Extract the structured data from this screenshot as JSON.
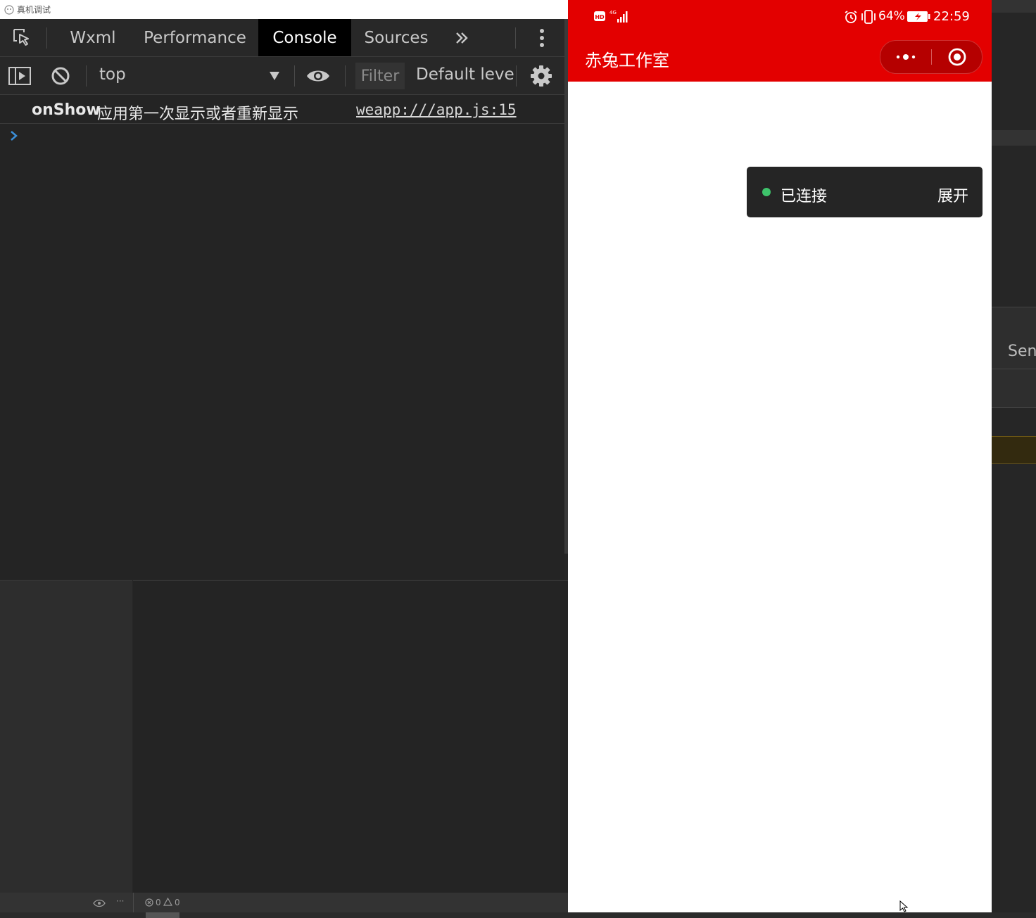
{
  "window": {
    "title": "真机调试"
  },
  "devtools": {
    "tabs": [
      {
        "label": "Wxml",
        "active": false
      },
      {
        "label": "Performance",
        "active": false
      },
      {
        "label": "Console",
        "active": true
      },
      {
        "label": "Sources",
        "active": false
      }
    ],
    "more_tabs_icon": "double-chevron-right-icon",
    "menu_icon": "vertical-dots-icon",
    "toolbar": {
      "context": "top",
      "filter_placeholder": "Filter",
      "level": "Default leve"
    },
    "console": {
      "entries": [
        {
          "method": "onShow",
          "message": "应用第一次显示或者重新显示",
          "source": "weapp:///app.js:15"
        }
      ],
      "prompt": "›"
    }
  },
  "statusbar": {
    "errors": "0",
    "warnings": "0"
  },
  "phone": {
    "status": {
      "network": "4G",
      "battery": "64%",
      "time": "22:59"
    },
    "nav": {
      "title": "赤兔工作室"
    },
    "toast": {
      "status": "已连接",
      "action": "展开",
      "dot_color": "#3ec36b"
    }
  },
  "right_panel": {
    "label": "Sen"
  },
  "colors": {
    "accent_red": "#e30000",
    "active_tab": "#000000",
    "link_blue": "#3b8fd9"
  }
}
